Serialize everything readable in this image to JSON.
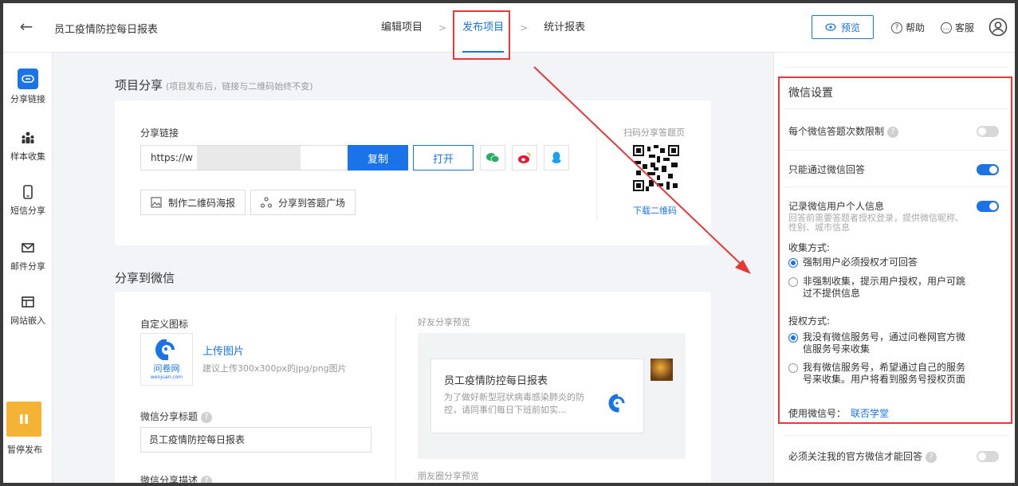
{
  "header": {
    "title": "员工疫情防控每日报表",
    "steps": [
      "编辑项目",
      "发布项目",
      "统计报表"
    ],
    "preview": "预览",
    "help": "帮助",
    "service": "客服"
  },
  "sidebar": {
    "items": [
      "分享链接",
      "样本收集",
      "短信分享",
      "邮件分享",
      "网站嵌入"
    ],
    "pause": "暂停发布"
  },
  "share": {
    "title": "项目分享",
    "note": "(项目发布后，链接与二维码始终不变)",
    "link_label": "分享链接",
    "url": "https://w",
    "copy": "复制",
    "open": "打开",
    "poster": "制作二维码海报",
    "square": "分享到答题广场",
    "qr_label": "扫码分享答题页",
    "qr_download": "下载二维码"
  },
  "wechat_share": {
    "title": "分享到微信",
    "icon_label": "自定义图标",
    "upload": "上传图片",
    "upload_hint": "建议上传300x300px的jpg/png图片",
    "logo_text": "问卷网",
    "logo_sub": "wenjuan.com",
    "share_title_label": "微信分享标题",
    "share_title_value": "员工疫情防控每日报表",
    "desc_label": "微信分享描述",
    "friend_preview": "好友分享预览",
    "preview_title": "员工疫情防控每日报表",
    "preview_desc": "为了做好新型冠状病毒感染肺炎的防控，请同事们每日下班前如实...",
    "moments_preview": "朋友圈分享预览"
  },
  "wechat_settings": {
    "title": "微信设置",
    "limit": "每个微信答题次数限制",
    "only_wechat": "只能通过微信回答",
    "record": "记录微信用户个人信息",
    "record_note": "回答前需要答题者授权登录，提供微信昵称、性别、城市信息",
    "collect_label": "收集方式:",
    "collect_opt1": "强制用户必须授权才可回答",
    "collect_opt2": "非强制收集，提示用户授权，用户可跳过不提供信息",
    "auth_label": "授权方式:",
    "auth_opt1": "我没有微信服务号，通过问卷网官方微信服务号来收集",
    "auth_opt2": "我有微信服务号，希望通过自己的服务号来收集。用户将看到服务号授权页面",
    "use_account_label": "使用微信号：",
    "use_account_value": "联否学堂",
    "follow": "必须关注我的官方微信才能回答"
  },
  "colors": {
    "accent": "#1a73e8",
    "highlight": "#e53935",
    "pause": "#f5b335"
  }
}
